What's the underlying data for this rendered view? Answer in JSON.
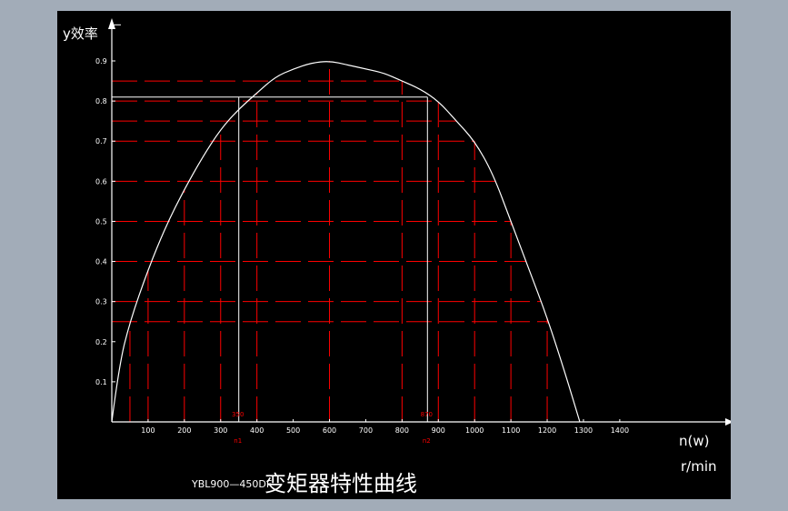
{
  "colors": {
    "background": "#000000",
    "outer": "#a2acb8",
    "curve": "#ffffff",
    "guides": "#ff0000",
    "axis": "#ffffff",
    "marker_text": "#ff0000"
  },
  "chart_data": {
    "type": "line",
    "title": "YBL900—450DF变矩器特性曲线",
    "title_prefix": "YBL900—450DF",
    "title_main": "变矩器特性曲线",
    "ylabel": "y效率",
    "xlabel_line1": "n(w)",
    "xlabel_line2": "r/min",
    "xlim": [
      0,
      1400
    ],
    "ylim": [
      0,
      0.9
    ],
    "x_ticks": [
      100,
      200,
      300,
      400,
      500,
      600,
      700,
      800,
      900,
      1000,
      1100,
      1200,
      1300,
      1400
    ],
    "y_ticks": [
      0.1,
      0.2,
      0.3,
      0.4,
      0.5,
      0.6,
      0.7,
      0.8,
      0.9
    ],
    "y_tick_labels": [
      "0.1",
      "0.2",
      "0.3",
      "0.4",
      "0.5",
      "0.6",
      "0.7",
      "0.8",
      "0.9"
    ],
    "series": [
      {
        "x": [
          0,
          20,
          50,
          100,
          150,
          200,
          250,
          300,
          350,
          400,
          450,
          500,
          550,
          600,
          650,
          700,
          750,
          800,
          850,
          900,
          950,
          1000,
          1050,
          1100,
          1150,
          1200,
          1250,
          1290
        ],
        "y": [
          0.0,
          0.14,
          0.25,
          0.38,
          0.49,
          0.58,
          0.66,
          0.73,
          0.78,
          0.82,
          0.86,
          0.88,
          0.895,
          0.9,
          0.89,
          0.88,
          0.87,
          0.85,
          0.83,
          0.8,
          0.75,
          0.7,
          0.62,
          0.5,
          0.38,
          0.26,
          0.12,
          0.0
        ]
      }
    ],
    "reference_lines": {
      "horizontal": [
        0.85,
        0.8,
        0.75,
        0.7,
        0.6,
        0.5,
        0.4,
        0.3,
        0.25
      ],
      "vertical": [
        50,
        100,
        200,
        300,
        400,
        600,
        800,
        900,
        1000,
        1100,
        1200
      ]
    },
    "markers": [
      {
        "x": 350,
        "label": "350",
        "sub": "n1"
      },
      {
        "x": 870,
        "label": "870",
        "sub": "n2"
      }
    ],
    "marker_level": 0.81
  }
}
